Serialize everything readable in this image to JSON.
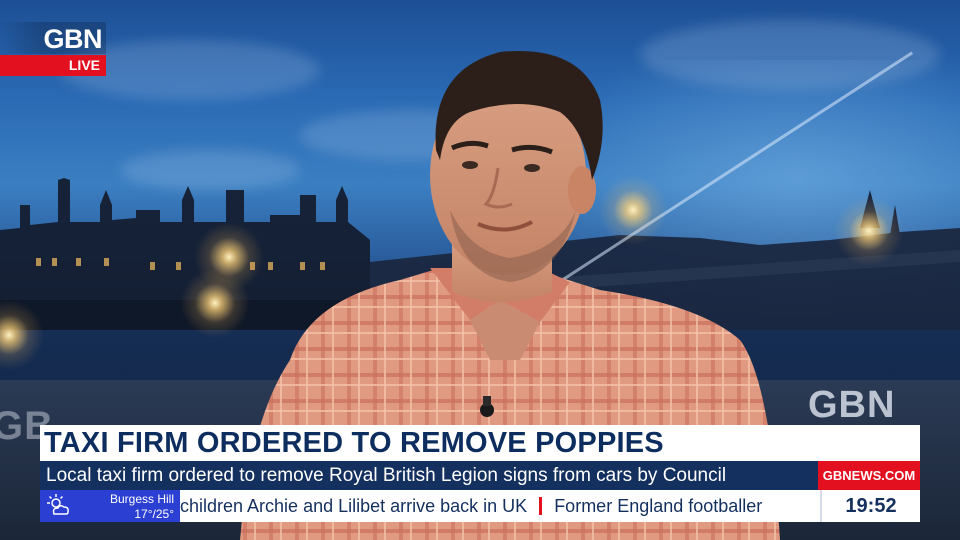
{
  "channel": {
    "logo_text": "GBN",
    "live_label": "LIVE"
  },
  "studio": {
    "wall_logo": "GBN",
    "wall_logo_left": "GB"
  },
  "lower_third": {
    "headline": "TAXI FIRM ORDERED TO REMOVE POPPIES",
    "subheadline": "Local taxi firm ordered to remove Royal British Legion signs from cars by Council",
    "website": "GBNEWS.COM"
  },
  "weather": {
    "location": "Burgess Hill",
    "temperature": "17°/25°",
    "icon": "sun-cloud-icon"
  },
  "ticker": {
    "items": [
      "children Archie and Lilibet arrive back in UK",
      "Former England footballer"
    ]
  },
  "clock": {
    "time": "19:52"
  },
  "colors": {
    "brand_red": "#e3101f",
    "navy": "#14305f",
    "headline_text": "#0d2d5f",
    "weather_blue": "#2b3fd2"
  }
}
